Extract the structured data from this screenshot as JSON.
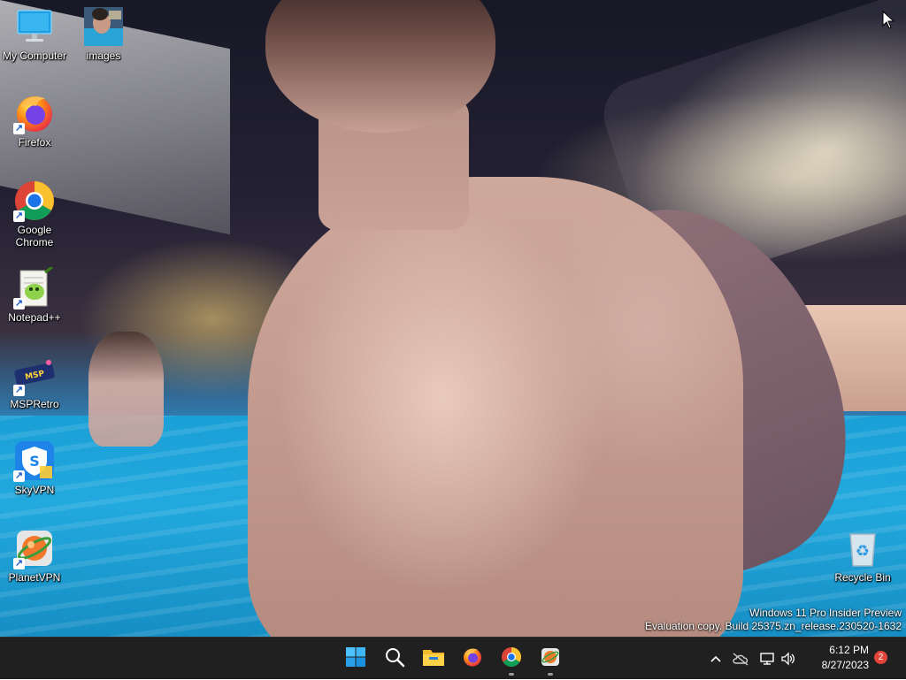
{
  "desktop": {
    "icons": [
      {
        "label": "My Computer",
        "icon": "monitor-icon"
      },
      {
        "label": "images",
        "icon": "image-thumbnail-icon"
      },
      {
        "label": "Firefox",
        "icon": "firefox-icon"
      },
      {
        "label": "Google Chrome",
        "icon": "chrome-icon"
      },
      {
        "label": "Notepad++",
        "icon": "notepadpp-icon"
      },
      {
        "label": "MSPRetro",
        "icon": "mspretro-icon"
      },
      {
        "label": "SkyVPN",
        "icon": "skyvpn-icon"
      },
      {
        "label": "PlanetVPN",
        "icon": "planetvpn-icon"
      },
      {
        "label": "Recycle Bin",
        "icon": "recycle-bin-icon"
      }
    ]
  },
  "watermark": {
    "line1": "Windows 11 Pro Insider Preview",
    "line2": "Evaluation copy. Build 25375.zn_release.230520-1632"
  },
  "taskbar": {
    "pinned": [
      "start-icon",
      "search-icon",
      "file-explorer-icon",
      "firefox-icon",
      "chrome-icon",
      "planetvpn-icon"
    ],
    "clock": {
      "time": "6:12 PM",
      "date": "8/27/2023"
    },
    "notification_count": "2"
  },
  "colors": {
    "taskbar_bg": "#202020",
    "accent": "#0078d4",
    "badge": "#e2463b"
  }
}
